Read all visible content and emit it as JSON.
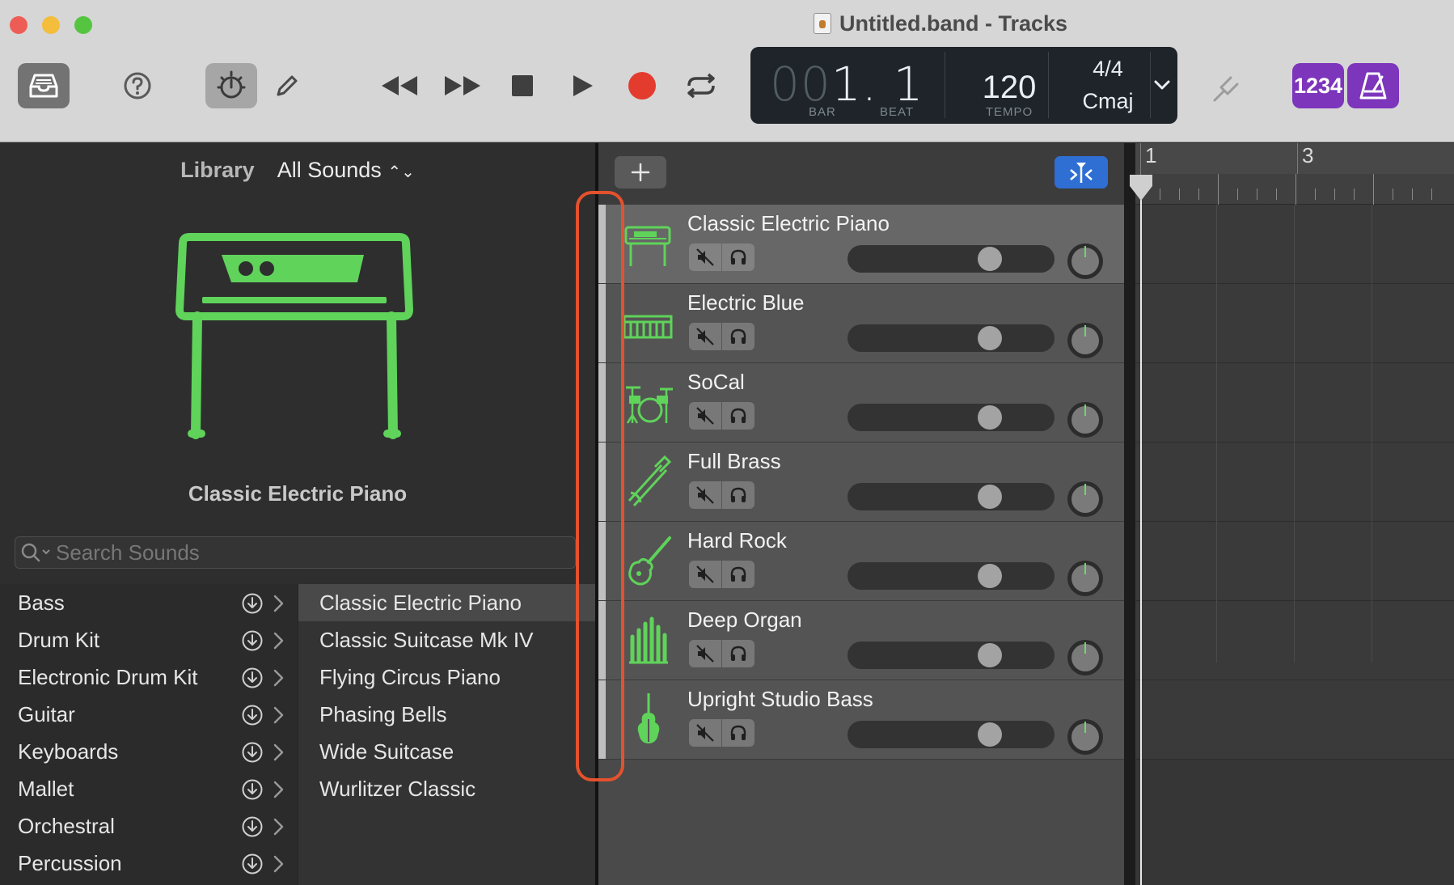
{
  "window": {
    "title": "Untitled.band - Tracks"
  },
  "toolbar": {
    "library_icon": "library-tray-icon",
    "help_icon": "help-icon",
    "smart_controls_icon": "smart-controls-icon",
    "editors_icon": "pencil-icon",
    "transport": [
      "rewind-icon",
      "fast-forward-icon",
      "stop-icon",
      "play-icon",
      "record-icon",
      "cycle-icon"
    ],
    "record_color": "#e33b2e",
    "count_in_label": "1234",
    "metronome_icon": "metronome-icon",
    "tuner_icon": "tuning-fork-icon",
    "accent_purple": "#7c35bb"
  },
  "lcd": {
    "position_dim": "00",
    "position_lit": "1. 1",
    "bar_label": "BAR",
    "beat_label": "BEAT",
    "tempo": "120",
    "tempo_label": "TEMPO",
    "time_signature": "4/4",
    "key": "Cmaj"
  },
  "library": {
    "title": "Library",
    "filter": "All Sounds",
    "hero_name": "Classic Electric Piano",
    "search_placeholder": "Search Sounds",
    "accent_green": "#5fd35a",
    "categories": [
      {
        "label": "Bass"
      },
      {
        "label": "Drum Kit"
      },
      {
        "label": "Electronic Drum Kit"
      },
      {
        "label": "Guitar"
      },
      {
        "label": "Keyboards"
      },
      {
        "label": "Mallet"
      },
      {
        "label": "Orchestral"
      },
      {
        "label": "Percussion"
      }
    ],
    "presets": [
      {
        "label": "Classic Electric Piano",
        "selected": true
      },
      {
        "label": "Classic Suitcase Mk IV"
      },
      {
        "label": "Flying Circus Piano"
      },
      {
        "label": "Phasing Bells"
      },
      {
        "label": "Wide Suitcase"
      },
      {
        "label": "Wurlitzer Classic"
      }
    ]
  },
  "tracks": [
    {
      "name": "Classic Electric Piano",
      "icon": "electric-piano-icon",
      "volume": 0.72,
      "selected": true
    },
    {
      "name": "Electric Blue",
      "icon": "synth-keyboard-icon",
      "volume": 0.72
    },
    {
      "name": "SoCal",
      "icon": "drum-kit-icon",
      "volume": 0.72
    },
    {
      "name": "Full Brass",
      "icon": "brass-icon",
      "volume": 0.72
    },
    {
      "name": "Hard Rock",
      "icon": "guitar-icon",
      "volume": 0.72
    },
    {
      "name": "Deep Organ",
      "icon": "organ-icon",
      "volume": 0.72
    },
    {
      "name": "Upright Studio Bass",
      "icon": "upright-bass-icon",
      "volume": 0.72
    }
  ],
  "ruler": {
    "bars": [
      "1",
      "3"
    ]
  }
}
